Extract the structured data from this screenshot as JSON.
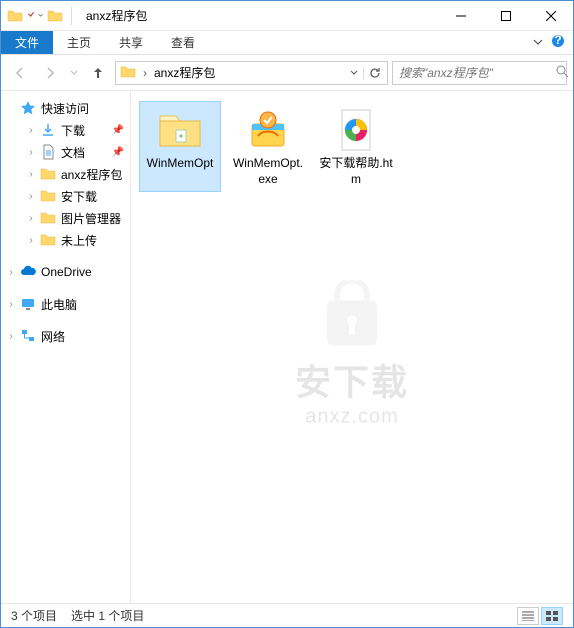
{
  "titlebar": {
    "title": "anxz程序包"
  },
  "ribbon": {
    "file": "文件",
    "tabs": [
      "主页",
      "共享",
      "查看"
    ]
  },
  "nav": {
    "breadcrumb": "anxz程序包",
    "search_placeholder": "搜索\"anxz程序包\""
  },
  "sidebar": {
    "quick": {
      "label": "快速访问",
      "items": [
        {
          "label": "下载",
          "pinned": true,
          "icon": "download"
        },
        {
          "label": "文档",
          "pinned": true,
          "icon": "document"
        },
        {
          "label": "anxz程序包",
          "icon": "folder"
        },
        {
          "label": "安下载",
          "icon": "folder"
        },
        {
          "label": "图片管理器",
          "icon": "folder"
        },
        {
          "label": "未上传",
          "icon": "folder"
        }
      ]
    },
    "onedrive": "OneDrive",
    "thispc": "此电脑",
    "network": "网络"
  },
  "files": [
    {
      "name": "WinMemOpt",
      "type": "folder",
      "selected": true
    },
    {
      "name": "WinMemOpt.exe",
      "type": "exe",
      "selected": false
    },
    {
      "name": "安下载帮助.htm",
      "type": "htm",
      "selected": false
    }
  ],
  "status": {
    "count": "3 个项目",
    "selected": "选中 1 个项目"
  },
  "watermark": {
    "text": "安下载",
    "url": "anxz.com"
  }
}
